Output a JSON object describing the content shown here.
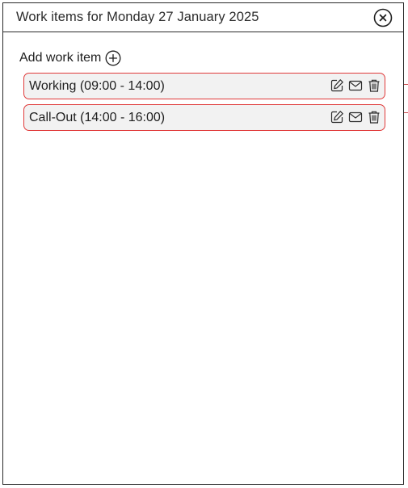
{
  "dialog": {
    "title": "Work items for Monday 27 January 2025",
    "close_icon": "close-circle-icon"
  },
  "add_work_item": {
    "label": "Add work item",
    "icon": "plus-circle-icon"
  },
  "work_items": [
    {
      "label": "Working (09:00 - 14:00)",
      "actions": [
        "edit-icon",
        "mail-icon",
        "trash-icon"
      ]
    },
    {
      "label": "Call-Out (14:00 - 16:00)",
      "actions": [
        "edit-icon",
        "mail-icon",
        "trash-icon"
      ]
    }
  ],
  "colors": {
    "item_border": "#e03a3a",
    "item_background": "#f2f2f2",
    "dialog_border": "#2a2a2a"
  }
}
